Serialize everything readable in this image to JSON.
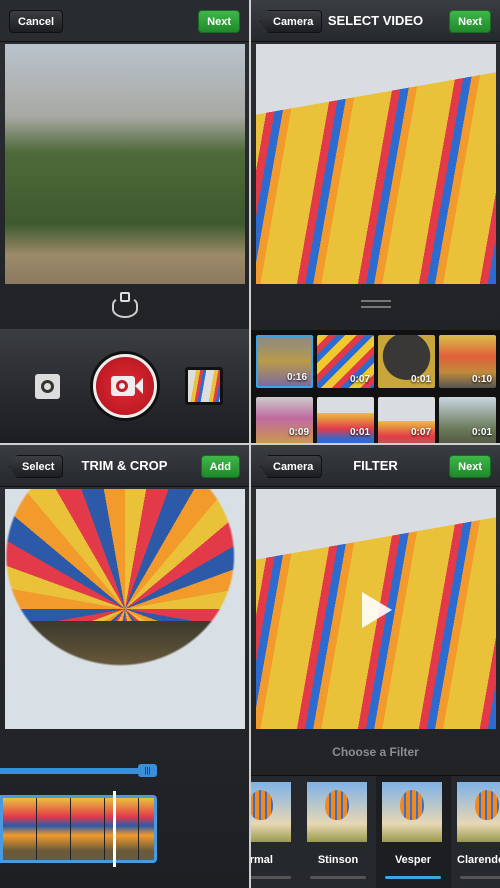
{
  "camera": {
    "cancel": "Cancel",
    "next": "Next"
  },
  "select_video": {
    "back": "Camera",
    "title": "SELECT VIDEO",
    "next": "Next",
    "videos": [
      {
        "duration": "0:16",
        "selected": true
      },
      {
        "duration": "0:07"
      },
      {
        "duration": "0:01"
      },
      {
        "duration": "0:10"
      },
      {
        "duration": "0:09"
      },
      {
        "duration": "0:01"
      },
      {
        "duration": "0:07"
      },
      {
        "duration": "0:01"
      }
    ]
  },
  "trim": {
    "back": "Select",
    "title": "TRIM & CROP",
    "add": "Add"
  },
  "filter": {
    "back": "Camera",
    "title": "FILTER",
    "next": "Next",
    "prompt": "Choose a Filter",
    "filters": [
      {
        "name": "Normal"
      },
      {
        "name": "Stinson"
      },
      {
        "name": "Vesper",
        "selected": true
      },
      {
        "name": "Clarendon"
      }
    ]
  },
  "colors": {
    "accent_green": "#2aa136",
    "record_red": "#d41f2a",
    "selection_blue": "#3aa6e8"
  }
}
